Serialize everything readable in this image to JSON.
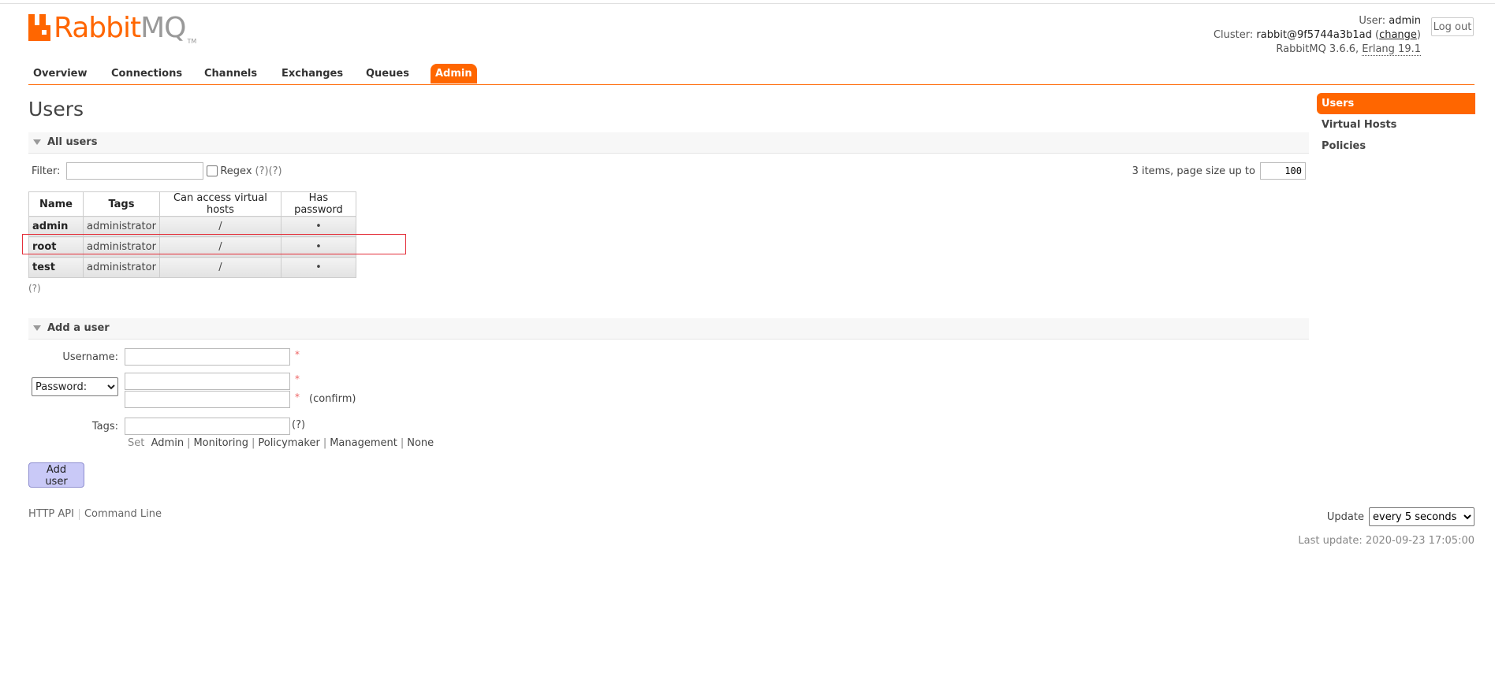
{
  "header": {
    "logo_main": "Rabbit",
    "logo_accent": "MQ",
    "logo_tm": "TM",
    "user_label": "User:",
    "user_value": "admin",
    "cluster_label": "Cluster:",
    "cluster_value": "rabbit@9f5744a3b1ad",
    "change_label": "change",
    "version_text": "RabbitMQ 3.6.6,",
    "erlang_text": "Erlang 19.1",
    "logout_label": "Log out"
  },
  "tabs": [
    "Overview",
    "Connections",
    "Channels",
    "Exchanges",
    "Queues",
    "Admin"
  ],
  "active_tab": "Admin",
  "sidebar": [
    "Users",
    "Virtual Hosts",
    "Policies"
  ],
  "page_title": "Users",
  "all_users": {
    "heading": "All users",
    "filter_label": "Filter:",
    "filter_value": "",
    "regex_label": "Regex",
    "regex_help": "(?)(?)",
    "paging_text": "3 items, page size up to",
    "page_size": "100",
    "columns": [
      "Name",
      "Tags",
      "Can access virtual hosts",
      "Has password"
    ],
    "rows": [
      {
        "name": "admin",
        "tags": "administrator",
        "vhosts": "/",
        "has_password": "•"
      },
      {
        "name": "root",
        "tags": "administrator",
        "vhosts": "/",
        "has_password": "•"
      },
      {
        "name": "test",
        "tags": "administrator",
        "vhosts": "/",
        "has_password": "•"
      }
    ],
    "table_help": "(?)"
  },
  "add_user": {
    "heading": "Add a user",
    "username_label": "Username:",
    "username_value": "",
    "password_mode": "Password:",
    "required_mark": "*",
    "confirm_label": "(confirm)",
    "tags_label": "Tags:",
    "tags_help": "(?)",
    "set_label": "Set",
    "tag_options": [
      "Admin",
      "Monitoring",
      "Policymaker",
      "Management",
      "None"
    ],
    "submit_label": "Add user"
  },
  "footer": {
    "links": [
      "HTTP API",
      "Command Line"
    ],
    "update_label": "Update",
    "update_value": "every 5 seconds",
    "last_update": "Last update: 2020-09-23 17:05:00"
  },
  "colors": {
    "accent": "#ff6600",
    "highlight_box": "#e4303b",
    "button_bg": "#c9c9f7"
  }
}
